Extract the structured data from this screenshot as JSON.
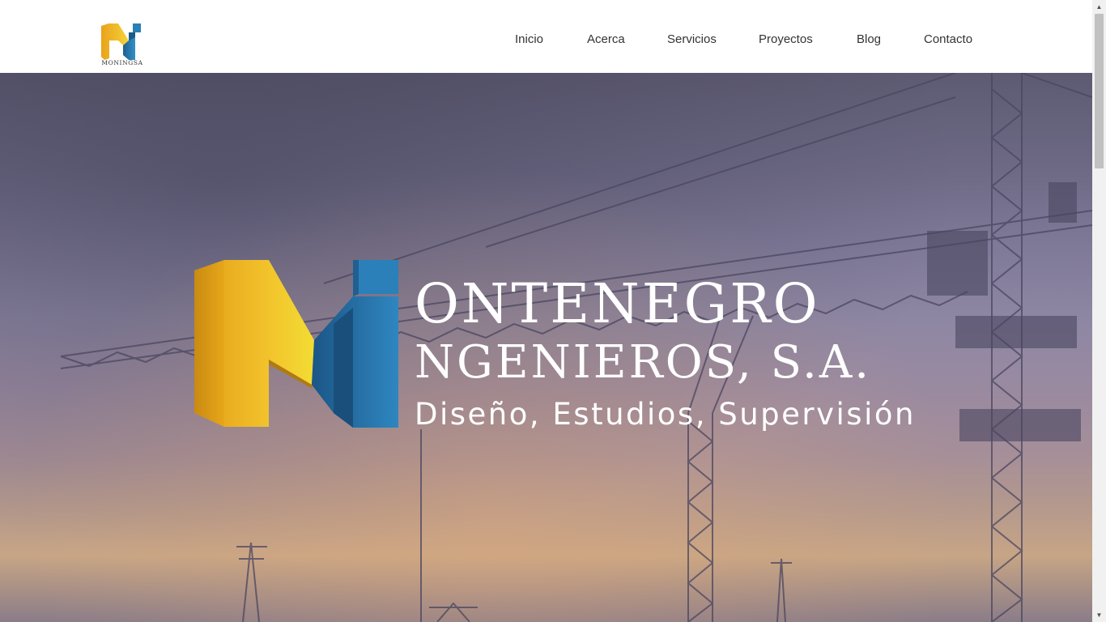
{
  "header": {
    "logo_text": "MONINGSA",
    "nav": [
      {
        "label": "Inicio"
      },
      {
        "label": "Acerca"
      },
      {
        "label": "Servicios"
      },
      {
        "label": "Proyectos"
      },
      {
        "label": "Blog"
      },
      {
        "label": "Contacto"
      }
    ]
  },
  "hero": {
    "brand_line_1": "ONTENEGRO",
    "brand_line_2": "NGENIEROS, S.A.",
    "tagline": "Diseño, Estudios, Supervisión"
  },
  "colors": {
    "logo_yellow": "#f2b632",
    "logo_blue": "#2a7fb4",
    "nav_text": "#333333"
  },
  "scrollbar": {
    "up_icon": "triangle-up-icon",
    "down_icon": "triangle-down-icon"
  }
}
